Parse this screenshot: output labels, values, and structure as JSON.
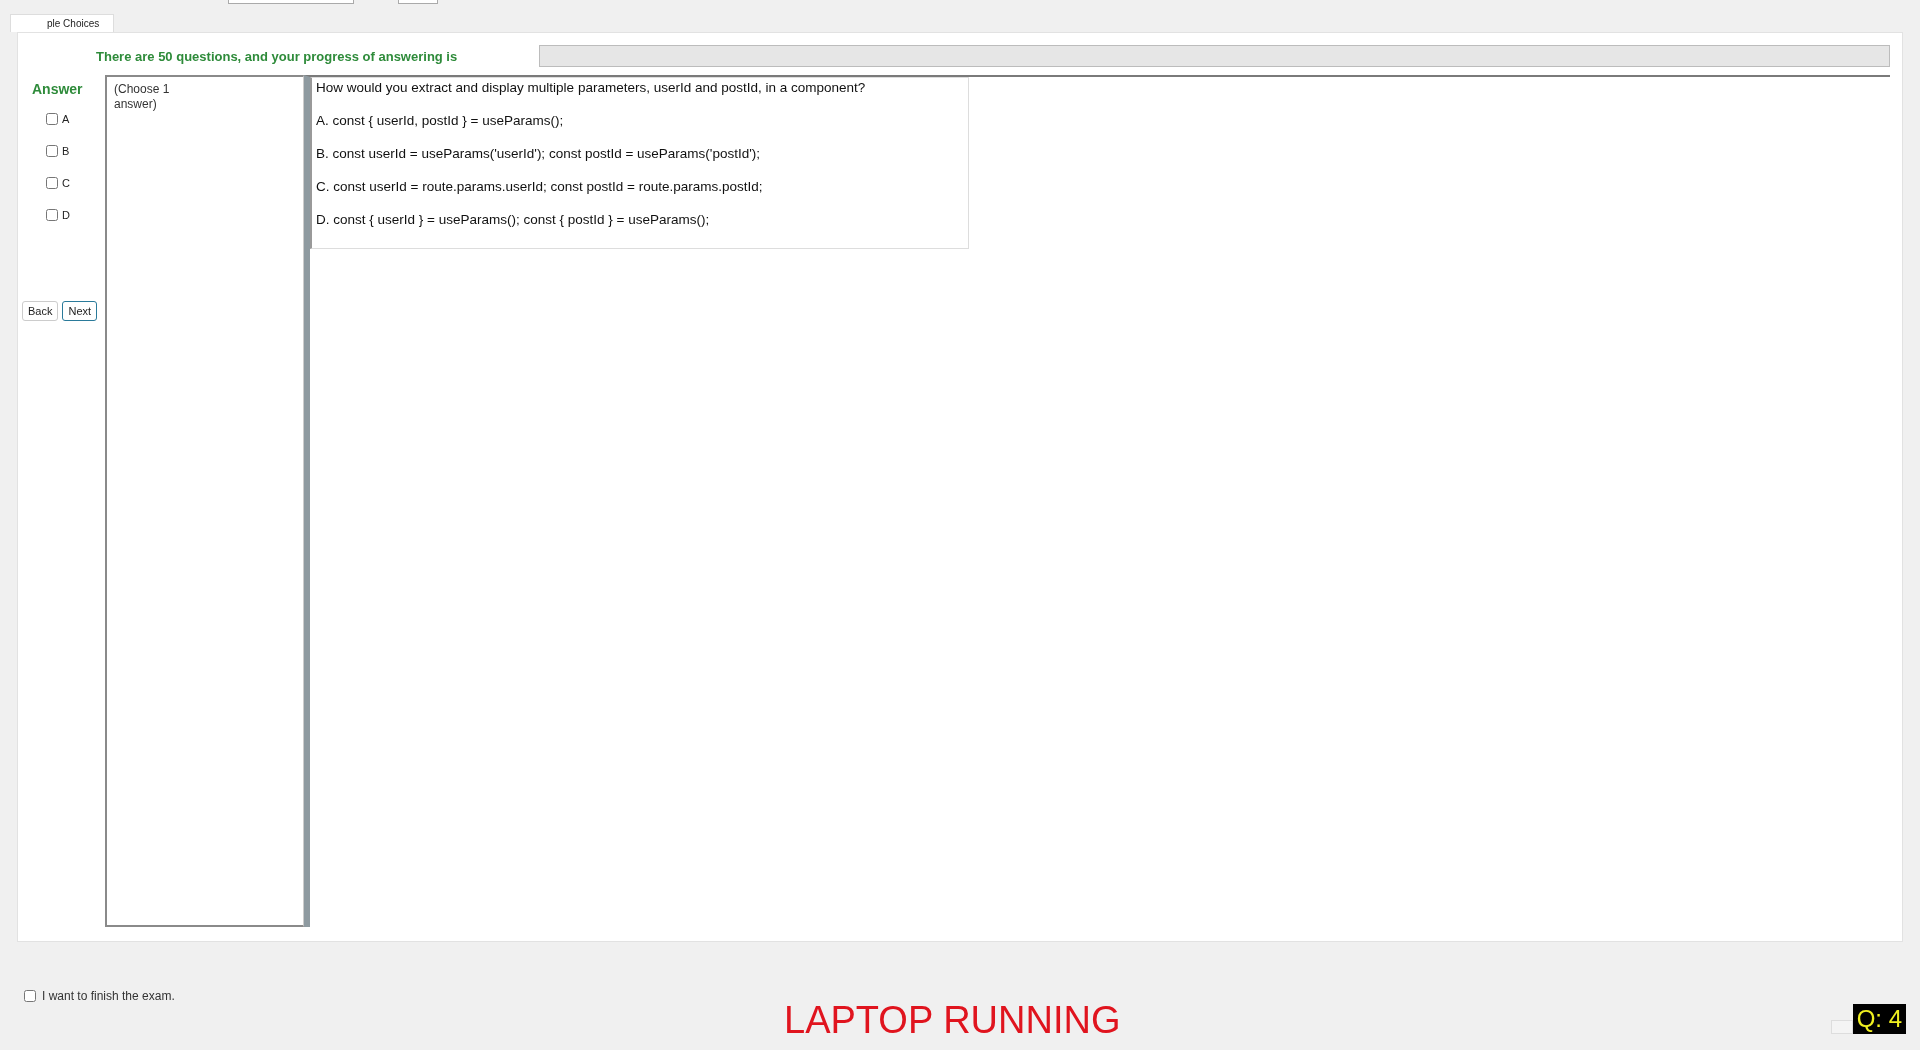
{
  "tab": {
    "label": "ple Choices",
    "selected": true
  },
  "progress": {
    "label": "There are 50 questions, and your progress of answering is",
    "level": 0
  },
  "answer": {
    "title": "Answer",
    "options": [
      {
        "label": "A",
        "checked": false
      },
      {
        "label": "B",
        "checked": false
      },
      {
        "label": "C",
        "checked": false
      },
      {
        "label": "D",
        "checked": false
      }
    ]
  },
  "buttons": [
    {
      "label": "Back",
      "focused": false
    },
    {
      "label": "Next",
      "focused": true
    }
  ],
  "hint": "(Choose 1 answer)",
  "question": {
    "text": "How would you extract and display multiple parameters, userId and postId, in a component?",
    "choices": [
      "A.  const { userId, postId } = useParams();",
      "B.  const userId = useParams('userId'); const postId = useParams('postId');",
      "C.  const userId = route.params.userId; const postId = route.params.postId;",
      "D.  const { userId } = useParams(); const { postId } = useParams();"
    ]
  },
  "finish": {
    "label": "I want to finish the exam.",
    "checked": false
  },
  "status": "LAPTOP RUNNING",
  "counter": "Q: 4"
}
